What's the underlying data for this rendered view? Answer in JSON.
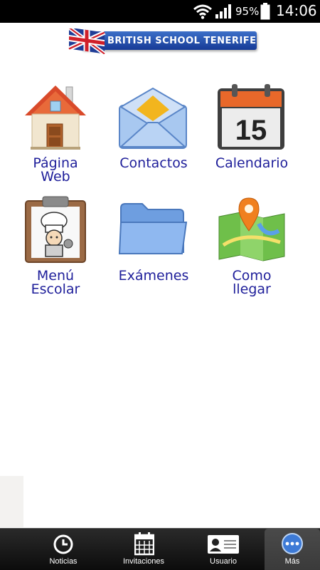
{
  "status_bar": {
    "battery_percent": "95%",
    "time": "14:06",
    "icons": [
      "wifi-icon",
      "signal-icon",
      "battery-icon"
    ]
  },
  "header": {
    "banner_text": "BRITISH SCHOOL TENERIFE",
    "logo_icon": "union-jack-flag-icon"
  },
  "grid": {
    "items": [
      {
        "line1": "Página",
        "line2": "Web",
        "icon": "house-icon"
      },
      {
        "line1": "Contactos",
        "line2": "",
        "icon": "envelope-icon"
      },
      {
        "line1": "Calendario",
        "line2": "",
        "icon": "calendar-icon",
        "calendar_day": "15"
      },
      {
        "line1": "Menú",
        "line2": "Escolar",
        "icon": "chef-clipboard-icon"
      },
      {
        "line1": "Exámenes",
        "line2": "",
        "icon": "folder-icon"
      },
      {
        "line1": "Como",
        "line2": "llegar",
        "icon": "map-pin-icon"
      }
    ]
  },
  "tab_bar": {
    "tabs": [
      {
        "label": "Noticias",
        "icon": "clock-icon"
      },
      {
        "label": "Invitaciones",
        "icon": "calendar-grid-icon"
      },
      {
        "label": "Usuario",
        "icon": "id-card-icon"
      },
      {
        "label": "Más",
        "icon": "more-dots-icon"
      }
    ],
    "active_tab": "Más"
  },
  "colors": {
    "label_text": "#1e1e9a",
    "banner_blue": "#1f4aa8",
    "tab_bar_bg": "#111111",
    "active_accent": "#3d7ad6"
  }
}
